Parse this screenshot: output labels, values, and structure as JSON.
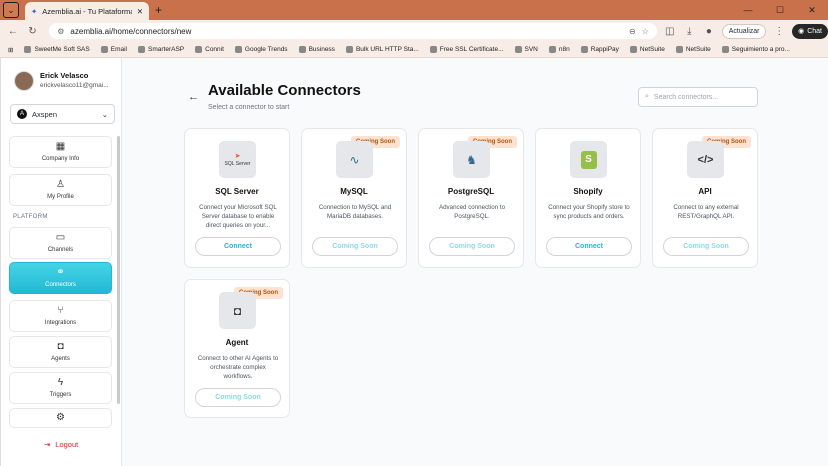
{
  "browser": {
    "tab_title": "Azemblia.ai - Tu Plataforma de Ap",
    "url": "azemblia.ai/home/connectors/new",
    "update_label": "Actualizar",
    "chat_label": "Chat",
    "bookmarks": [
      "SweetMe Soft SAS",
      "Email",
      "SmarterASP",
      "Connit",
      "Google Trends",
      "Business",
      "Bulk URL HTTP Sta...",
      "Free SSL Certificate...",
      "SVN",
      "n8n",
      "RappiPay",
      "NetSuite",
      "NetSuite",
      "Seguimiento a pro..."
    ]
  },
  "sidebar": {
    "user_name": "Erick Velasco",
    "user_email": "erickvelasco11@gmai...",
    "org_name": "Axspen",
    "section_label": "PLATFORM",
    "items": [
      {
        "label": "Company Info",
        "icon": "building-icon"
      },
      {
        "label": "My Profile",
        "icon": "user-icon"
      },
      {
        "label": "Channels",
        "icon": "chat-icon"
      },
      {
        "label": "Connectors",
        "icon": "link-icon"
      },
      {
        "label": "Integrations",
        "icon": "integrations-icon"
      },
      {
        "label": "Agents",
        "icon": "robot-icon"
      },
      {
        "label": "Triggers",
        "icon": "bolt-icon"
      },
      {
        "label": "",
        "icon": "gear-icon"
      }
    ],
    "logout_label": "Logout"
  },
  "main": {
    "title": "Available Connectors",
    "subtitle": "Select a connector to start",
    "search_placeholder": "Search connectors...",
    "connectors": [
      {
        "name": "SQL Server",
        "desc": "Connect your Microsoft SQL Server database to enable direct queries on your...",
        "button": "Connect",
        "badge": "",
        "logo_text": "SQL Server"
      },
      {
        "name": "MySQL",
        "desc": "Connection to MySQL and MariaDB databases.",
        "button": "Coming Soon",
        "badge": "Coming Soon",
        "logo_text": ""
      },
      {
        "name": "PostgreSQL",
        "desc": "Advanced connection to PostgreSQL.",
        "button": "Coming Soon",
        "badge": "Coming Soon",
        "logo_text": ""
      },
      {
        "name": "Shopify",
        "desc": "Connect your Shopify store to sync products and orders.",
        "button": "Connect",
        "badge": "",
        "logo_text": ""
      },
      {
        "name": "API",
        "desc": "Connect to any external REST/GraphQL API.",
        "button": "Coming Soon",
        "badge": "Coming Soon",
        "logo_text": ""
      },
      {
        "name": "Agent",
        "desc": "Connect to other AI Agents to orchestrate complex workflows.",
        "button": "Coming Soon",
        "badge": "Coming Soon",
        "logo_text": ""
      }
    ]
  },
  "colors": {
    "accent": "#22b8d4",
    "danger": "#dc2626",
    "badge_bg": "#fde2d2",
    "chrome": "#c8714a"
  }
}
